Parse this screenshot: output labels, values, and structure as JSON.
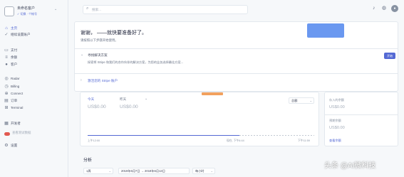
{
  "account": {
    "name": "未命名客户",
    "sub_actions": "✓ 切换 · 个帐号"
  },
  "sidebar": {
    "items": [
      {
        "label": "主页",
        "icon": "home-icon",
        "glyph": "⌂"
      },
      {
        "label": "继续设置账户",
        "icon": "checklist-icon",
        "glyph": "✓"
      },
      {
        "label": "支付",
        "icon": "card-icon",
        "glyph": "▭"
      },
      {
        "label": "余额",
        "icon": "balance-icon",
        "glyph": "≡"
      },
      {
        "label": "客户",
        "icon": "customers-icon",
        "glyph": "●"
      },
      {
        "label": "Radar",
        "icon": "radar-icon",
        "glyph": "◎"
      },
      {
        "label": "Billing",
        "icon": "billing-icon",
        "glyph": "◷"
      },
      {
        "label": "Connect",
        "icon": "connect-icon",
        "glyph": "⊕"
      },
      {
        "label": "订单",
        "icon": "orders-icon",
        "glyph": "▤"
      },
      {
        "label": "Terminal",
        "icon": "terminal-icon",
        "glyph": "⊞"
      },
      {
        "label": "开发者",
        "icon": "developers-icon",
        "glyph": "▦"
      },
      {
        "label": "查看测试数据",
        "icon": "test-data-toggle-icon",
        "glyph": ""
      },
      {
        "label": "设置",
        "icon": "settings-icon",
        "glyph": "⚙"
      }
    ]
  },
  "search": {
    "placeholder": "搜索..."
  },
  "hero": {
    "title": "谢谢，         ——就快要准备好了。",
    "subtitle": "请按照以下步骤开始使用。"
  },
  "setup_row": {
    "title": "寻找解决方案",
    "desc": "探索将 Stripe 和我们的合作伙伴的解决方案，为您的业务选择最佳方案...",
    "button": "开始"
  },
  "activate_link": "激活您的 Stripe 账户",
  "chart_card": {
    "now_tag": "",
    "today_label": "今天",
    "yesterday_label": "昨天",
    "today_value": "US$0.00",
    "yesterday_value": "US$0.00",
    "select_value": "总额",
    "axis_left": "上午12:00",
    "axis_mid": "现在, 下午6:44",
    "axis_right": "下午11:59"
  },
  "side_card": {
    "label1": "存入的余额",
    "value1": "US$0.00",
    "label2": "预期余额",
    "value2": "US$0.00",
    "link": "查看余额"
  },
  "analytics": {
    "title": "分析",
    "period": "1周",
    "date_range": "2019年6月7日 → 2019年6月13日",
    "compare": "每小时"
  },
  "watermark": "头条 @AI微科技",
  "colors": {
    "accent": "#5469d4",
    "sidebar_bg": "#f6f8fa",
    "toggle": "#e25950"
  }
}
